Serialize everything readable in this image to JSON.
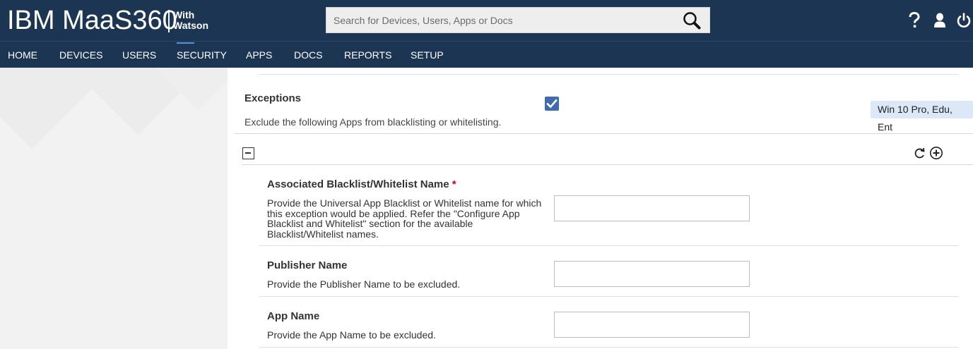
{
  "header": {
    "brand": "IBM MaaS360",
    "brand_sub_1": "With",
    "brand_sub_2": "Watson",
    "search_placeholder": "Search for Devices, Users, Apps or Docs",
    "icons": [
      "search-icon",
      "help-icon",
      "user-icon",
      "power-icon"
    ]
  },
  "nav": {
    "items": [
      "HOME",
      "DEVICES",
      "USERS",
      "SECURITY",
      "APPS",
      "DOCS",
      "REPORTS",
      "SETUP"
    ],
    "active": "SECURITY"
  },
  "exceptions": {
    "title": "Exceptions",
    "description": "Exclude the following Apps from blacklisting or whitelisting.",
    "checked": true,
    "platform": "Win 10 Pro, Edu, Ent"
  },
  "fields": [
    {
      "label": "Associated Blacklist/Whitelist Name",
      "required_mark": "*",
      "description": "Provide the Universal App Blacklist or Whitelist name for which this exception would be applied. Refer the \"Configure App Blacklist and Whitelist\" section for the available Blacklist/Whitelist names.",
      "value": ""
    },
    {
      "label": "Publisher Name",
      "description": "Provide the Publisher Name to be excluded.",
      "value": ""
    },
    {
      "label": "App Name",
      "description": "Provide the App Name to be excluded.",
      "value": ""
    }
  ],
  "colors": {
    "header_bg": "#1c3553",
    "checkbox": "#3f6bb3",
    "badge_bg": "#dce8f7",
    "required": "#d0021b"
  }
}
